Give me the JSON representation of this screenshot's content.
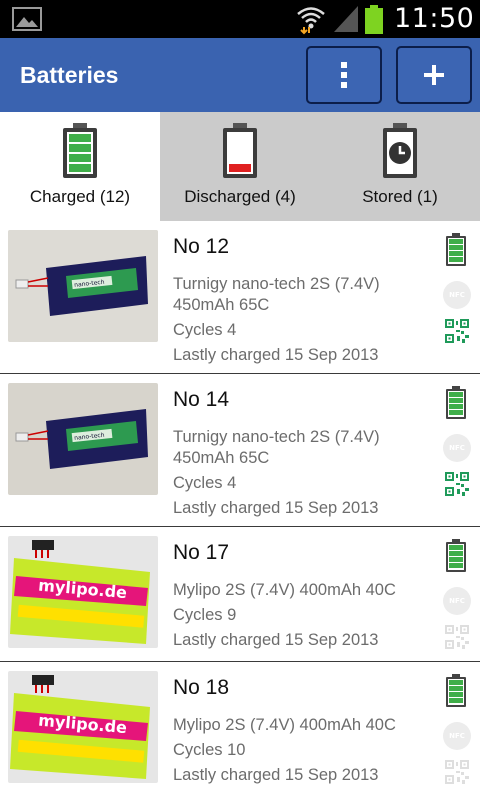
{
  "status_bar": {
    "time": "11:50",
    "icons": [
      "gallery-icon",
      "wifi-icon",
      "signal-icon",
      "battery-icon"
    ]
  },
  "action_bar": {
    "title": "Batteries",
    "menu_icon": "overflow-menu-icon",
    "add_icon": "add-icon",
    "add_glyph": "+",
    "bg_color": "#3a63b0"
  },
  "tabs": [
    {
      "label": "Charged (12)",
      "icon": "battery-charged-icon",
      "active": true
    },
    {
      "label": "Discharged (4)",
      "icon": "battery-discharged-icon",
      "active": false
    },
    {
      "label": "Stored (1)",
      "icon": "battery-stored-icon",
      "active": false
    }
  ],
  "batteries": [
    {
      "name": "No 12",
      "model_line1": "Turnigy nano-tech 2S (7.4V)",
      "model_line2": "450mAh 65C",
      "cycles": "Cycles 4",
      "last_charged": "Lastly charged 15 Sep 2013",
      "thumb_label": "nano-tech",
      "qr_active": true
    },
    {
      "name": "No 14",
      "model_line1": "Turnigy nano-tech 2S (7.4V)",
      "model_line2": "450mAh 65C",
      "cycles": "Cycles 4",
      "last_charged": "Lastly charged 15 Sep 2013",
      "thumb_label": "nano-tech",
      "qr_active": true
    },
    {
      "name": "No 17",
      "model_line1": "Mylipo 2S (7.4V) 400mAh 40C",
      "model_line2": "",
      "cycles": "Cycles 9",
      "last_charged": "Lastly charged 15 Sep 2013",
      "thumb_label": "mylipo.de",
      "qr_active": false
    },
    {
      "name": "No 18",
      "model_line1": "Mylipo 2S (7.4V) 400mAh 40C",
      "model_line2": "",
      "cycles": "Cycles 10",
      "last_charged": "Lastly charged 15 Sep 2013",
      "thumb_label": "mylipo.de",
      "qr_active": false
    }
  ],
  "nfc_label": "NFC",
  "colors": {
    "accent_green": "#2e9a4a",
    "charged_fill": "#3fae49",
    "discharged_red": "#e02020",
    "qr_active": "#1f9a5a",
    "qr_inactive": "#dedede"
  }
}
